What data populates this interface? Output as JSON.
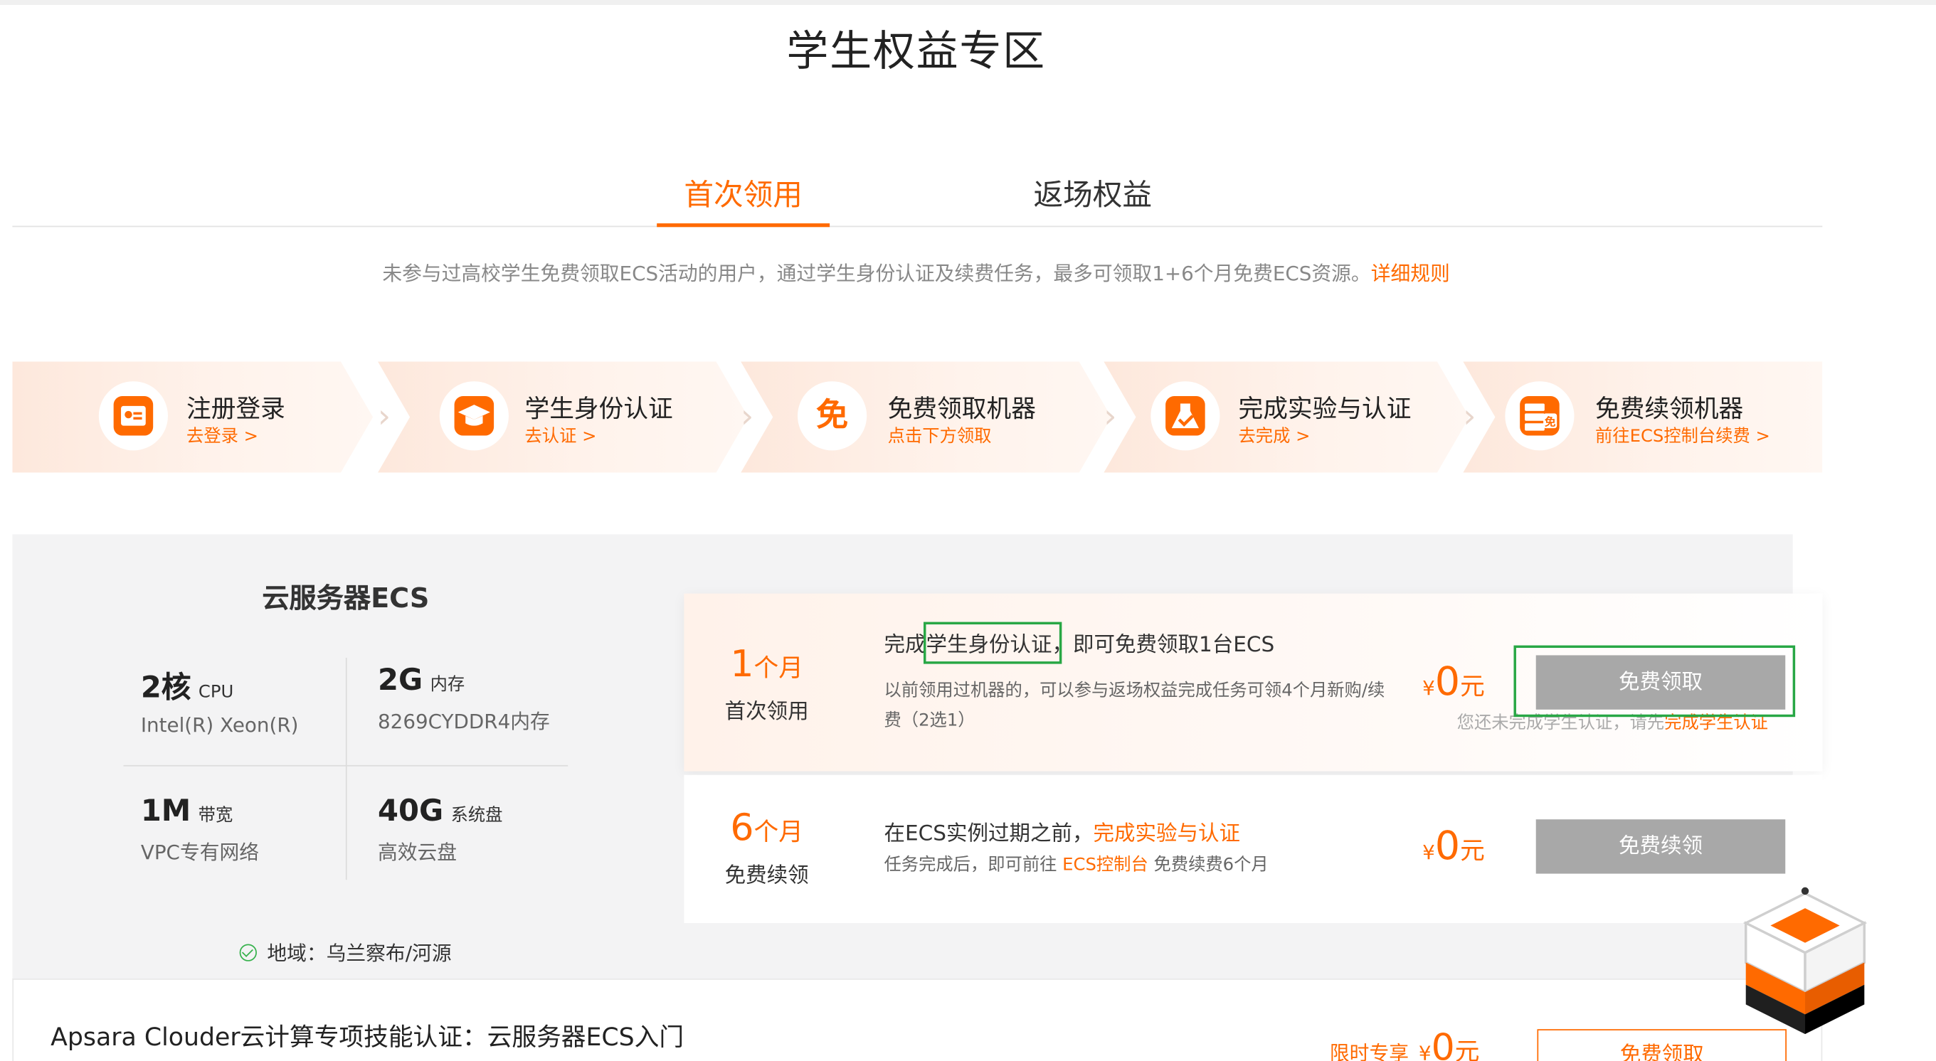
{
  "page_title": "学生权益专区",
  "tabs": [
    {
      "label": "首次领用",
      "active": true
    },
    {
      "label": "返场权益",
      "active": false
    }
  ],
  "notice": {
    "text": "未参与过高校学生免费领取ECS活动的用户，通过学生身份认证及续费任务，最多可领取1+6个月免费ECS资源。",
    "link": "详细规则"
  },
  "steps": [
    {
      "title": "注册登录",
      "link": "去登录 >",
      "icon": "id-card-icon"
    },
    {
      "title": "学生身份认证",
      "link": "去认证 >",
      "icon": "graduation-cap-icon"
    },
    {
      "title": "免费领取机器",
      "link": "点击下方领取",
      "icon": "free-badge-icon",
      "glyph": "免"
    },
    {
      "title": "完成实验与认证",
      "link": "去完成 >",
      "icon": "flask-icon"
    },
    {
      "title": "免费续领机器",
      "link": "前往ECS控制台续费 >",
      "icon": "server-free-icon"
    }
  ],
  "product": {
    "title": "云服务器ECS",
    "specs": [
      {
        "big": "2核",
        "unit": "CPU",
        "desc": "Intel(R) Xeon(R)"
      },
      {
        "big": "2G",
        "unit": "内存",
        "desc": "8269CYDDR4内存"
      },
      {
        "big": "1M",
        "unit": "带宽",
        "desc": "VPC专有网络"
      },
      {
        "big": "40G",
        "unit": "系统盘",
        "desc": "高效云盘"
      }
    ],
    "region": "地域：乌兰察布/河源"
  },
  "offers": [
    {
      "period_num": "1",
      "period_unit": "个月",
      "period_label": "首次领用",
      "main_prefix": "完成",
      "main_highlight": "学生身份认证",
      "main_suffix": "，即可免费领取1台ECS",
      "sub": "以前领用过机器的，可以参与返场权益完成任务可领4个月新购/续费（2选1）",
      "currency": "¥",
      "price": "0",
      "price_unit": "元",
      "button": "免费领取",
      "tip_prefix": "您还未完成学生认证，请先",
      "tip_link": "完成学生认证"
    },
    {
      "period_num": "6",
      "period_unit": "个月",
      "period_label": "免费续领",
      "main_prefix": "在ECS实例过期之前，",
      "main_highlight": "完成实验与认证",
      "sub_prefix": "任务完成后，即可前往 ",
      "sub_link": "ECS控制台",
      "sub_suffix": " 免费续费6个月",
      "currency": "¥",
      "price": "0",
      "price_unit": "元",
      "button": "免费续领"
    }
  ],
  "course": {
    "title": "Apsara Clouder云计算专项技能认证：云服务器ECS入门",
    "price_label": "限时专享",
    "currency": "¥",
    "price": "0",
    "price_unit": "元",
    "button": "免费领取"
  },
  "colors": {
    "accent": "#ff6a00",
    "highlight_box": "#28a745",
    "button_disabled": "#a8a8a8"
  }
}
